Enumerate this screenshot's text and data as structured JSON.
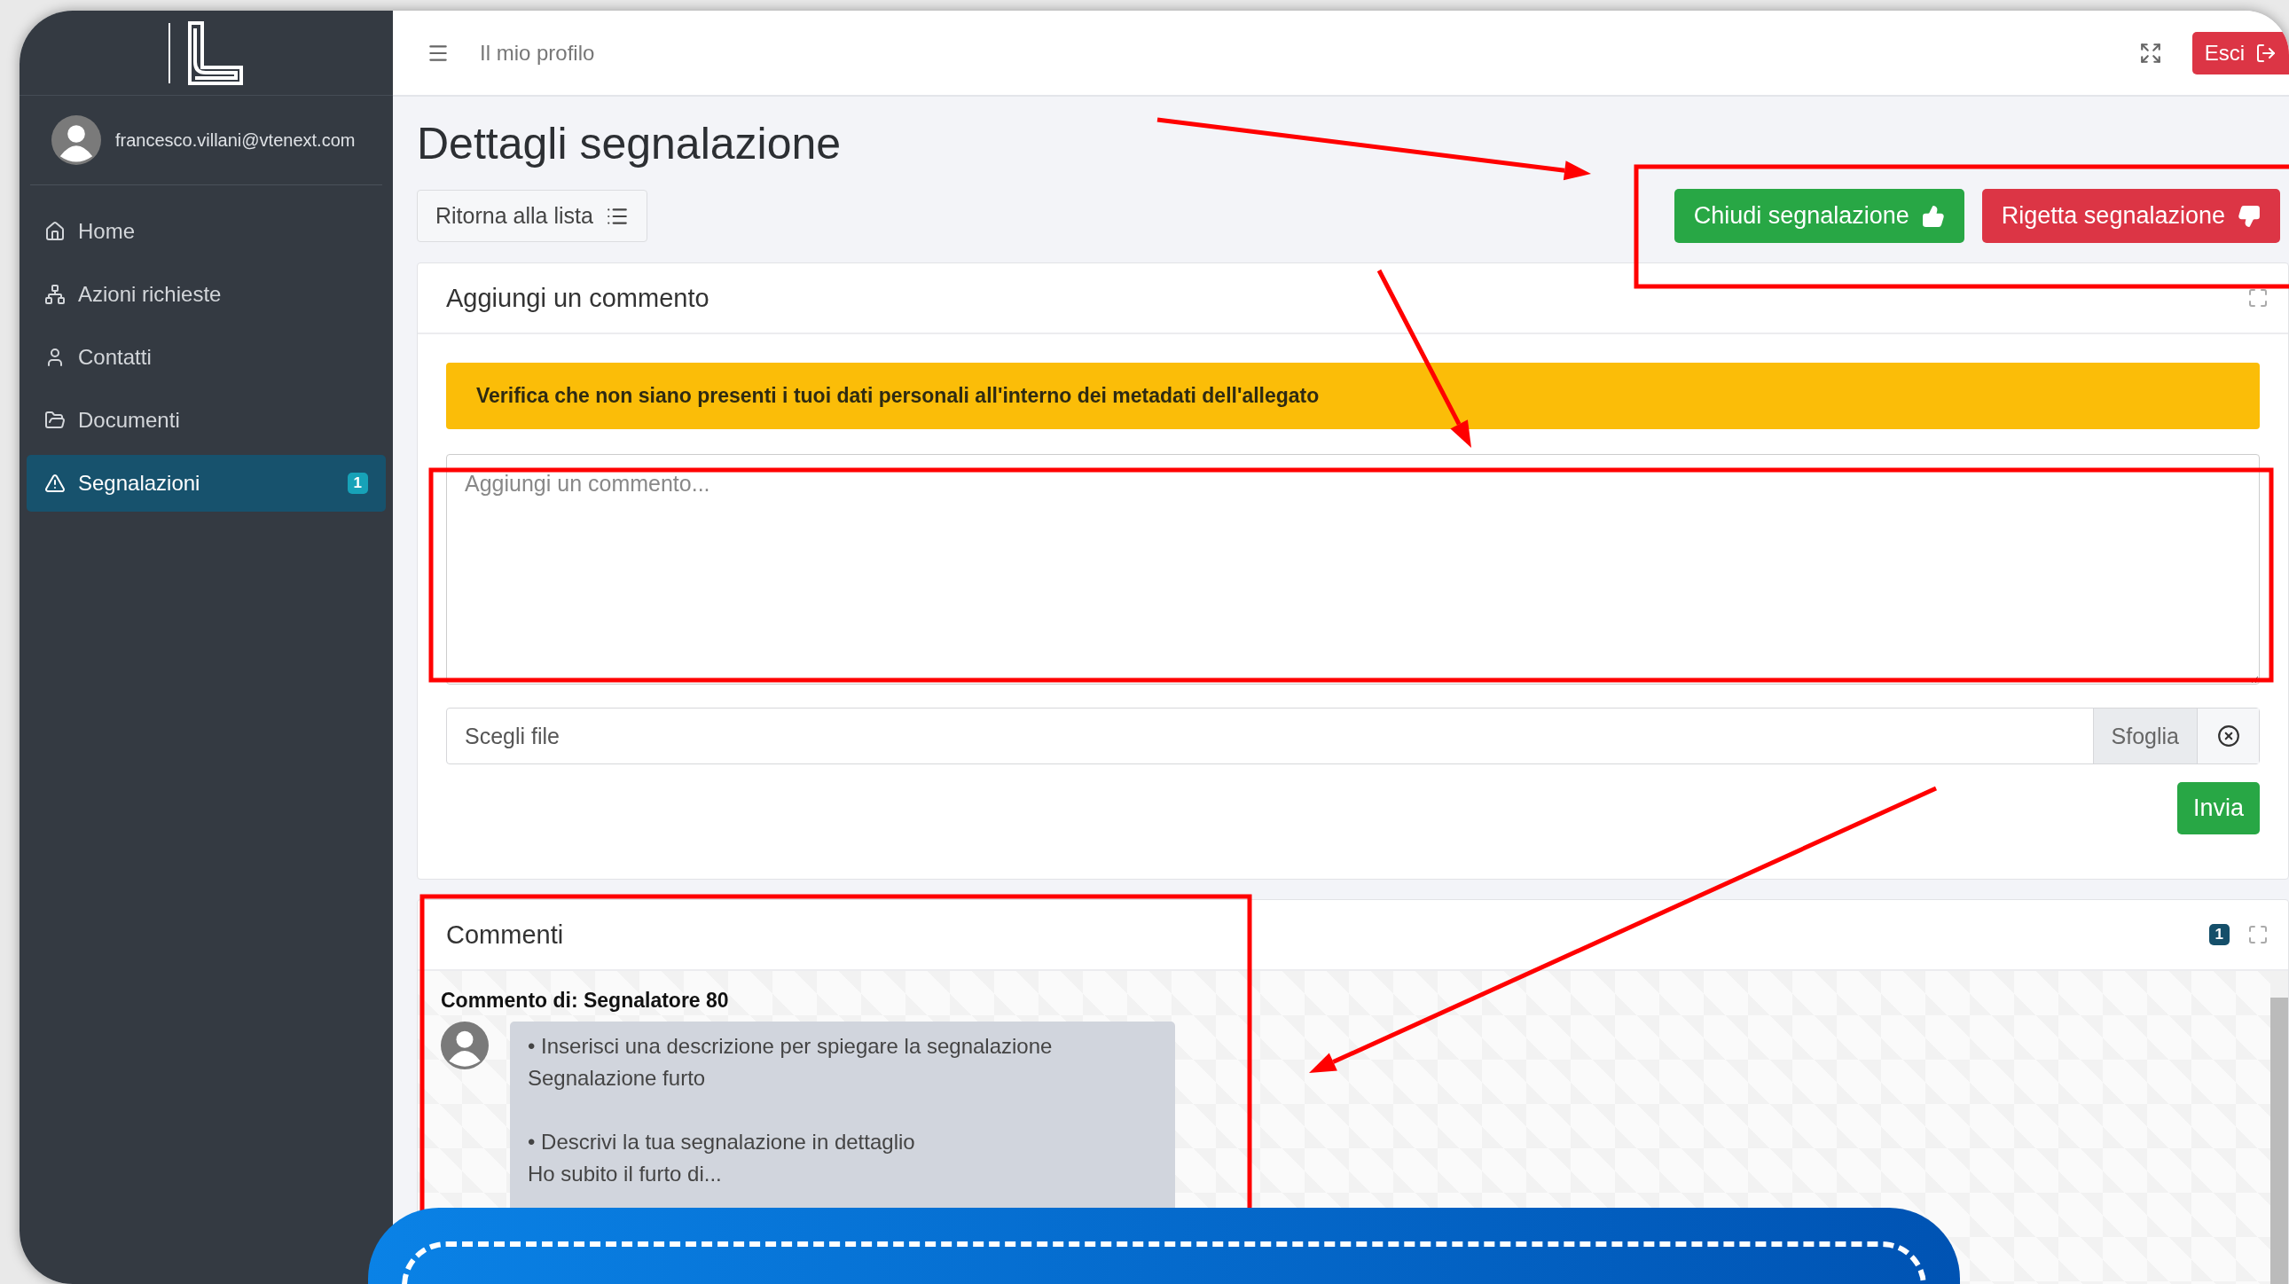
{
  "sidebar": {
    "user": {
      "email": "francesco.villani@vtenext.com"
    },
    "items": [
      {
        "label": "Home",
        "kind": "home",
        "selected": false
      },
      {
        "label": "Azioni richieste",
        "kind": "actions",
        "selected": false
      },
      {
        "label": "Contatti",
        "kind": "contacts",
        "selected": false
      },
      {
        "label": "Documenti",
        "kind": "documents",
        "selected": false
      },
      {
        "label": "Segnalazioni",
        "kind": "reports",
        "selected": true,
        "badge": "1"
      }
    ]
  },
  "topbar": {
    "breadcrumb": "Il mio profilo",
    "logout": "Esci"
  },
  "page": {
    "title": "Dettagli segnalazione",
    "back_button": "Ritorna alla lista",
    "actions": [
      {
        "label": "Chiudi segnalazione",
        "kind": "close"
      },
      {
        "label": "Rigetta segnalazione",
        "kind": "reject"
      }
    ]
  },
  "comment_form": {
    "title": "Aggiungi un commento",
    "alert": "Verifica che non siano presenti i tuoi dati personali all'interno dei metadati dell'allegato",
    "textarea": {
      "placeholder": "Aggiungi un commento..."
    },
    "file": {
      "placeholder": "Scegli file",
      "browse": "Sfoglia"
    },
    "submit": "Invia"
  },
  "comments": {
    "title": "Commenti",
    "count": "1",
    "items": [
      {
        "author": "Commento di: Segnalatore 80",
        "paragraphs": [
          {
            "question": "• Inserisci una descrizione per spiegare la segnalazione",
            "answer": "Segnalazione furto"
          },
          {
            "question": "• Descrivi la tua segnalazione in dettaglio",
            "answer": "Ho subito il furto di..."
          }
        ]
      }
    ]
  }
}
